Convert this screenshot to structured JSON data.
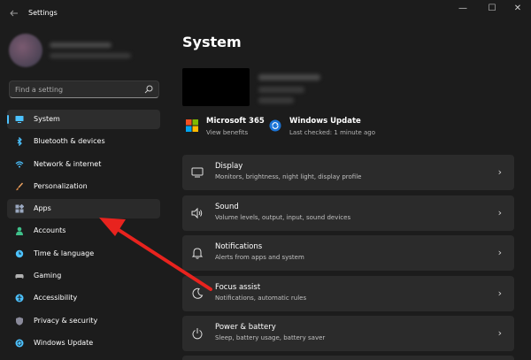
{
  "window": {
    "title": "Settings",
    "back_icon": "back-arrow-icon",
    "controls": [
      "minimize-icon",
      "maximize-icon",
      "close-icon"
    ],
    "control_glyphs": [
      "—",
      "☐",
      "✕"
    ]
  },
  "sidebar": {
    "search": {
      "placeholder": "Find a setting",
      "value": ""
    },
    "items": [
      {
        "label": "System",
        "icon": "system-display-icon",
        "selected": true,
        "color": "#4cc2ff"
      },
      {
        "label": "Bluetooth & devices",
        "icon": "bluetooth-icon",
        "color": "#4cc2ff"
      },
      {
        "label": "Network & internet",
        "icon": "wifi-icon",
        "color": "#4cc2ff"
      },
      {
        "label": "Personalization",
        "icon": "paintbrush-icon",
        "color": "#e8a060"
      },
      {
        "label": "Apps",
        "icon": "apps-icon",
        "hovered": true,
        "color": "#9aa8c0"
      },
      {
        "label": "Accounts",
        "icon": "person-icon",
        "color": "#3fc08a"
      },
      {
        "label": "Time & language",
        "icon": "globe-clock-icon",
        "color": "#4cc2ff"
      },
      {
        "label": "Gaming",
        "icon": "gamepad-icon",
        "color": "#b0b0b0"
      },
      {
        "label": "Accessibility",
        "icon": "accessibility-icon",
        "color": "#4cc2ff"
      },
      {
        "label": "Privacy & security",
        "icon": "shield-icon",
        "color": "#8a8a9a"
      },
      {
        "label": "Windows Update",
        "icon": "update-icon",
        "color": "#4cc2ff"
      }
    ]
  },
  "main": {
    "page_title": "System",
    "quick_links": [
      {
        "title": "Microsoft 365",
        "subtitle": "View benefits",
        "icon": "microsoft-365-icon"
      },
      {
        "title": "Windows Update",
        "subtitle": "Last checked: 1 minute ago",
        "icon": "windows-update-icon"
      }
    ],
    "cards": [
      {
        "title": "Display",
        "subtitle": "Monitors, brightness, night light, display profile",
        "icon": "display-icon"
      },
      {
        "title": "Sound",
        "subtitle": "Volume levels, output, input, sound devices",
        "icon": "speaker-icon"
      },
      {
        "title": "Notifications",
        "subtitle": "Alerts from apps and system",
        "icon": "bell-icon"
      },
      {
        "title": "Focus assist",
        "subtitle": "Notifications, automatic rules",
        "icon": "moon-icon"
      },
      {
        "title": "Power & battery",
        "subtitle": "Sleep, battery usage, battery saver",
        "icon": "power-icon"
      }
    ],
    "chevron_glyph": "›"
  },
  "annotation": {
    "icon": "red-pointer-arrow",
    "color": "#e8231e"
  },
  "colors": {
    "background": "#1c1c1c",
    "card": "#2b2b2b",
    "accent": "#4cc2ff"
  }
}
